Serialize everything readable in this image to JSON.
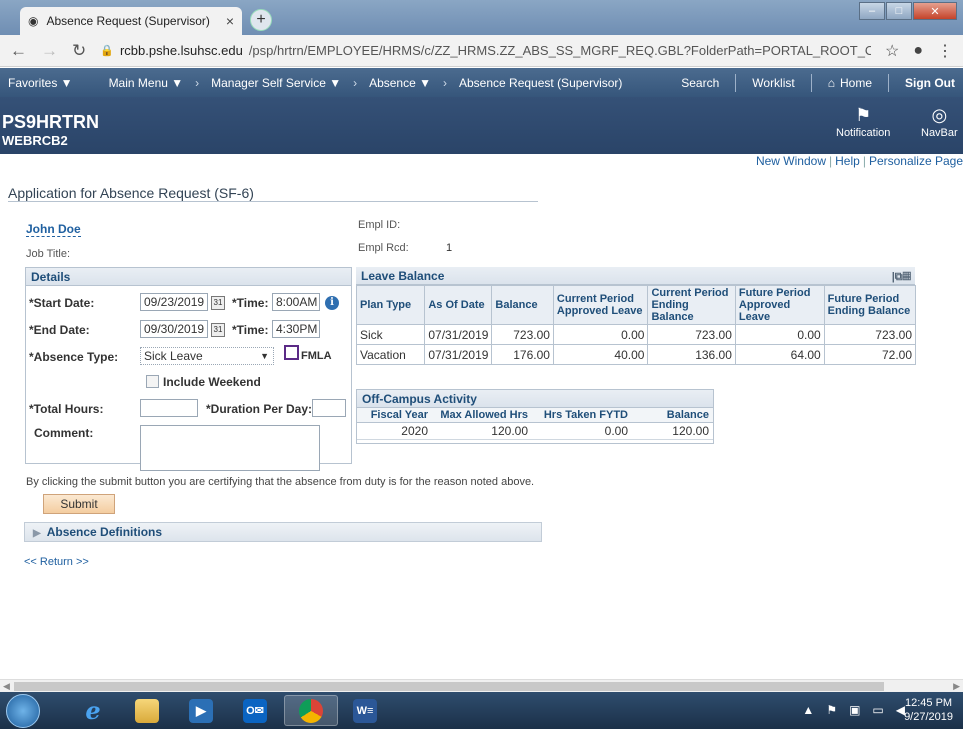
{
  "browser": {
    "tab_title": "Absence Request (Supervisor)",
    "url_host": "rcbb.pshe.lsuhsc.edu",
    "url_path": "/psp/hrtrn/EMPLOYEE/HRMS/c/ZZ_HRMS.ZZ_ABS_SS_MGRF_REQ.GBL?FolderPath=PORTAL_ROOT_OB..."
  },
  "menubar": {
    "favorites": "Favorites ▼",
    "main_menu": "Main Menu ▼",
    "manager_self_service": "Manager Self Service ▼",
    "absence": "Absence ▼",
    "current": "Absence Request (Supervisor)",
    "search": "Search",
    "worklist": "Worklist",
    "home": "Home",
    "sign_out": "Sign Out"
  },
  "banner": {
    "system": "PS9HRTRN",
    "database": "WEBRCB2",
    "notification": "Notification",
    "navbar": "NavBar"
  },
  "links": {
    "new_window": "New Window",
    "help": "Help",
    "personalize": "Personalize Page"
  },
  "page": {
    "title": "Application for Absence Request (SF-6)",
    "employee_name": "John Doe",
    "job_title_label": "Job Title:",
    "empl_id_label": "Empl ID:",
    "empl_rcd_label": "Empl Rcd:",
    "empl_rcd_value": "1"
  },
  "details": {
    "header": "Details",
    "start_date_label": "*Start Date:",
    "start_date": "09/23/2019",
    "start_time_label": "*Time:",
    "start_time": "8:00AM",
    "end_date_label": "*End Date:",
    "end_date": "09/30/2019",
    "end_time_label": "*Time:",
    "end_time": "4:30PM",
    "absence_type_label": "*Absence Type:",
    "absence_type": "Sick Leave",
    "fmla_label": "FMLA",
    "include_weekend_label": "Include Weekend",
    "total_hours_label": "*Total Hours:",
    "duration_label": "*Duration Per Day:",
    "comment_label": "Comment:",
    "calendar_icon_text": "31"
  },
  "leave_balance": {
    "header": "Leave Balance",
    "columns": [
      "Plan Type",
      "As Of Date",
      "Balance",
      "Current Period Approved Leave",
      "Current Period Ending Balance",
      "Future Period Approved Leave",
      "Future Period Ending Balance"
    ],
    "rows": [
      [
        "Sick",
        "07/31/2019",
        "723.00",
        "0.00",
        "723.00",
        "0.00",
        "723.00"
      ],
      [
        "Vacation",
        "07/31/2019",
        "176.00",
        "40.00",
        "136.00",
        "64.00",
        "72.00"
      ]
    ]
  },
  "off_campus": {
    "header": "Off-Campus Activity",
    "columns": [
      "Fiscal Year",
      "Max Allowed Hrs",
      "Hrs Taken FYTD",
      "Balance"
    ],
    "row": [
      "2020",
      "120.00",
      "0.00",
      "120.00"
    ]
  },
  "footer": {
    "certify": "By clicking the submit button you are certifying that the absence from duty is for the reason noted above.",
    "submit": "Submit",
    "absence_definitions": "Absence Definitions",
    "return": "<< Return >>"
  },
  "taskbar": {
    "time": "12:45 PM",
    "date": "9/27/2019"
  }
}
